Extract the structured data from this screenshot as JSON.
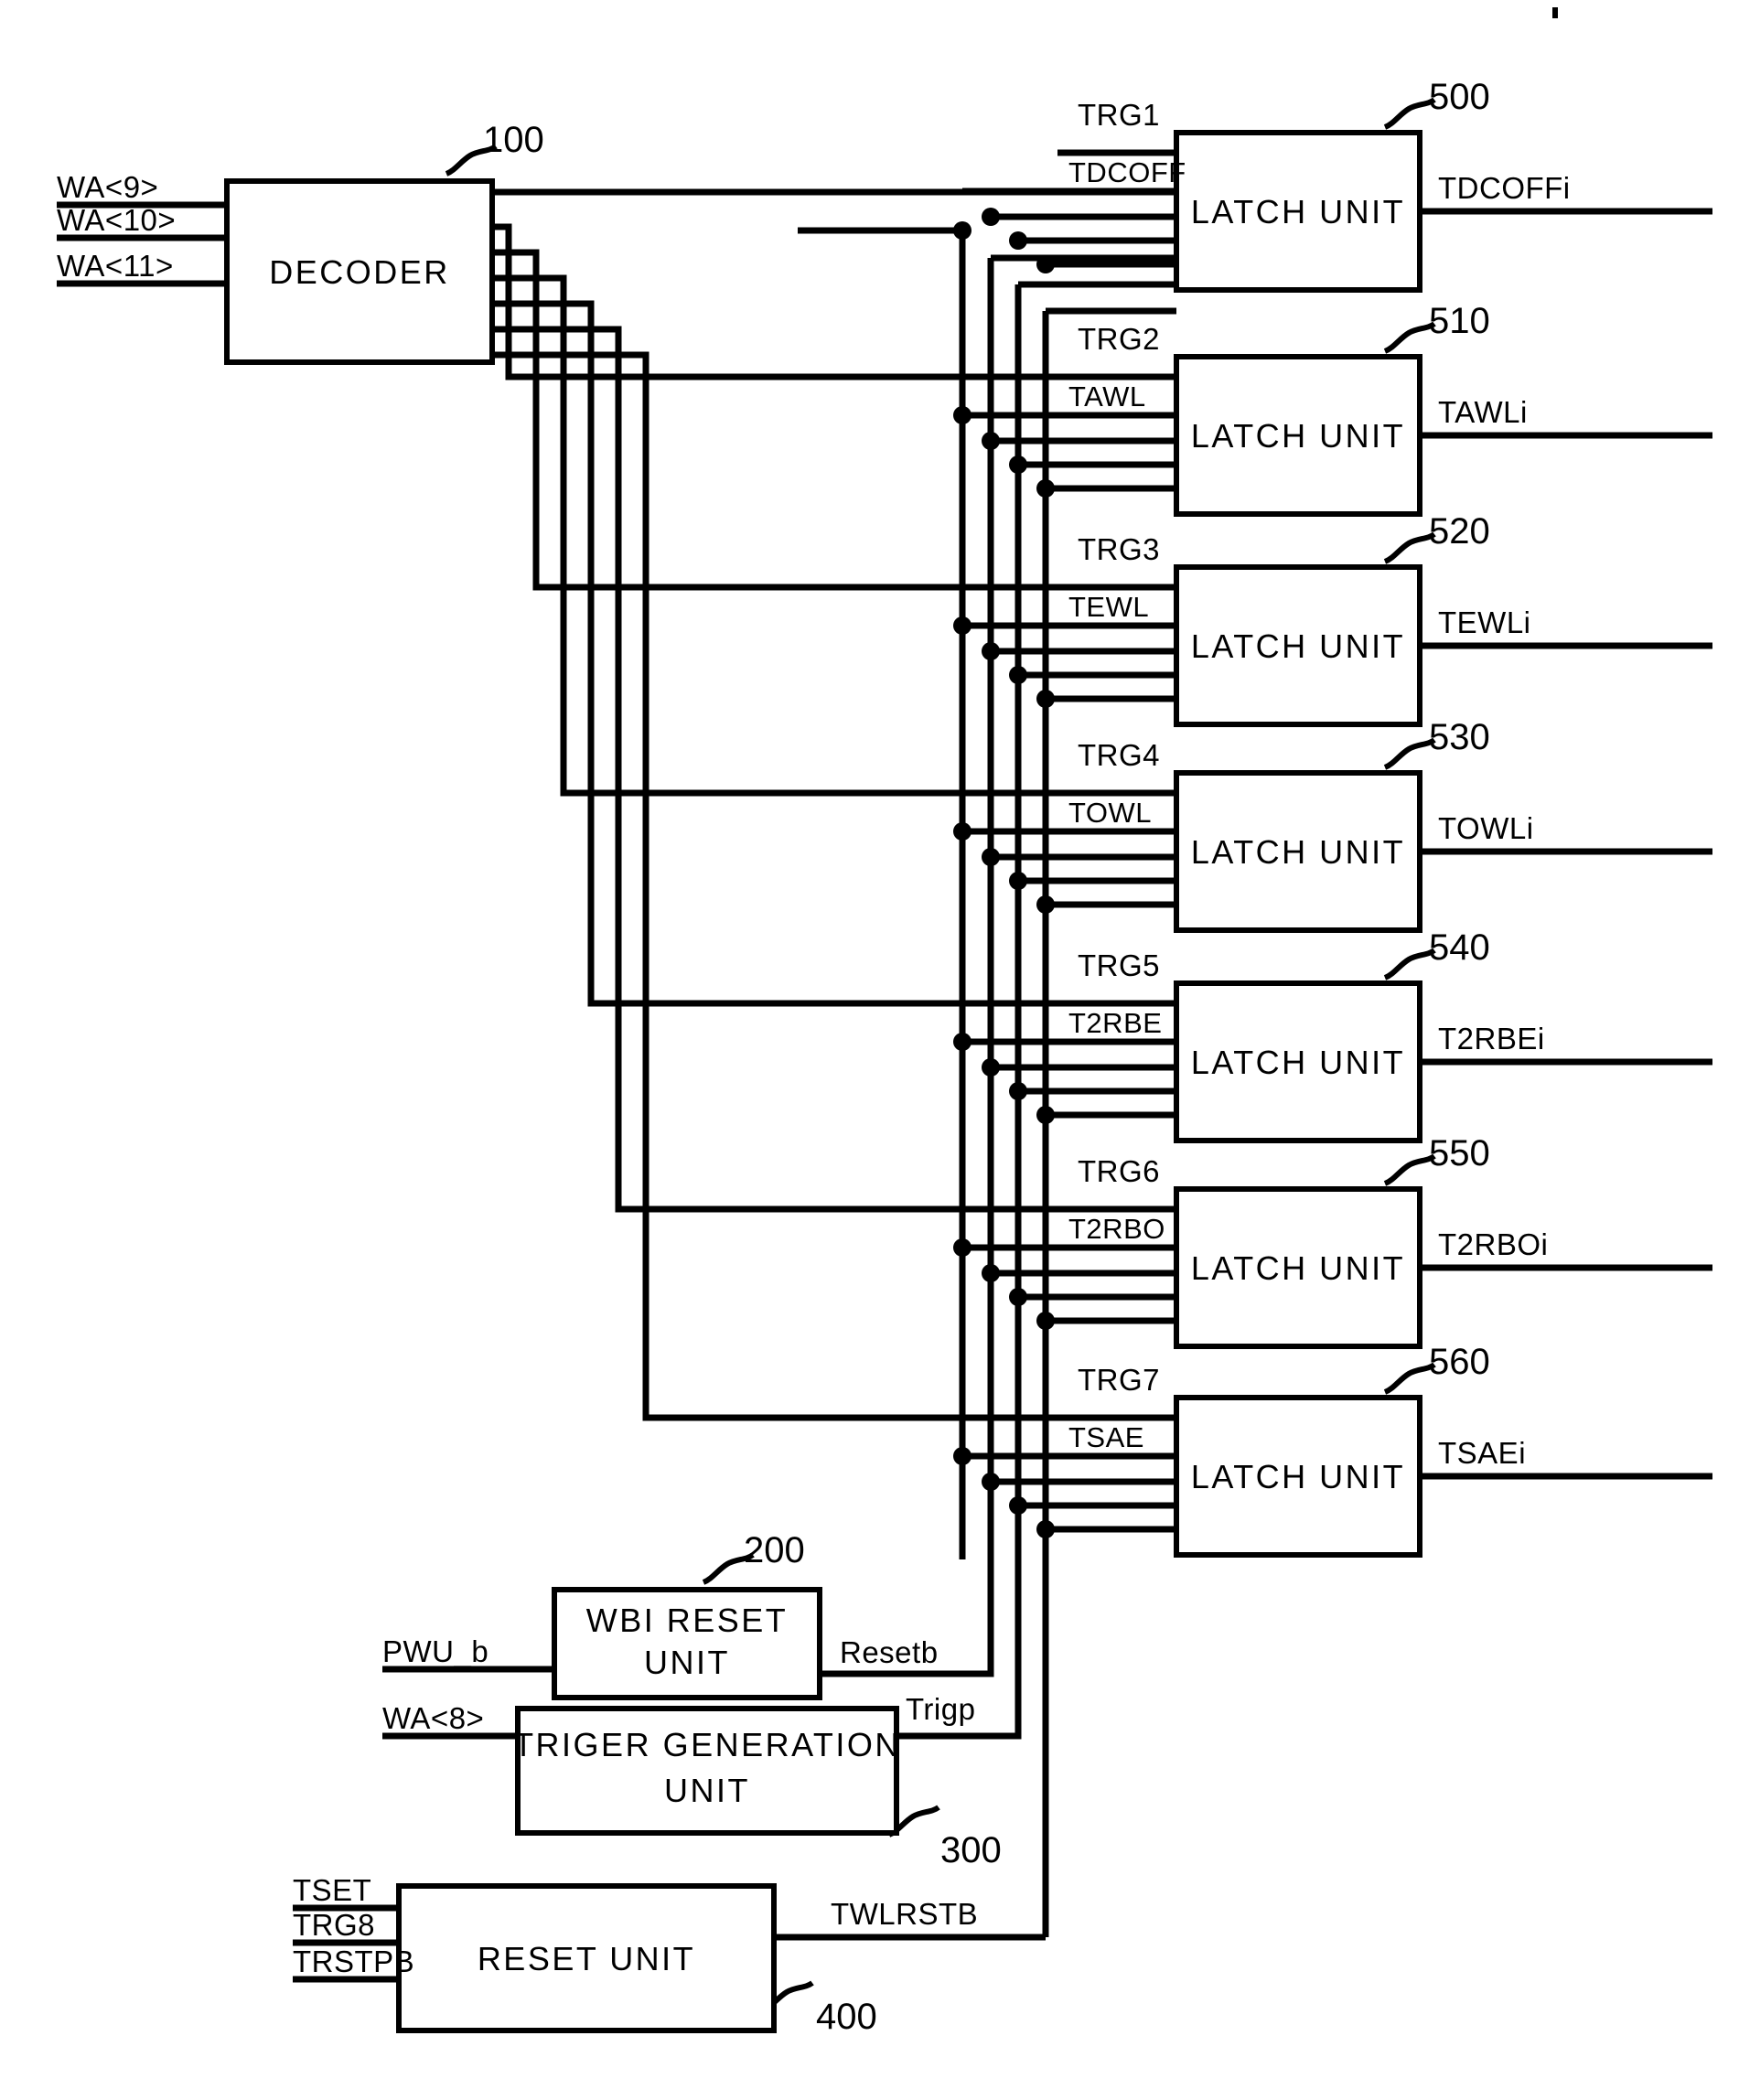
{
  "figure": {
    "kind": "patent-block-diagram",
    "ink_color": "#000000",
    "background": "#ffffff"
  },
  "blocks": {
    "decoder": {
      "label": "DECODER",
      "ref": "100",
      "inputs": [
        "WA<9>",
        "WA<10>",
        "WA<11>"
      ]
    },
    "wbi_reset": {
      "label_line1": "WBI RESET",
      "label_line2": "UNIT",
      "ref": "200",
      "inputs": [
        "PWU_b"
      ],
      "outputs": [
        "Resetb"
      ]
    },
    "trigger_generation": {
      "label_line1": "TRIGER GENERATION",
      "label_line2": "UNIT",
      "ref": "300",
      "inputs": [
        "WA<8>"
      ],
      "outputs": [
        "Trigp"
      ]
    },
    "reset_unit": {
      "label": "RESET UNIT",
      "ref": "400",
      "inputs": [
        "TSET",
        "TRG8",
        "TRSTPB"
      ],
      "outputs": [
        "TWLRSTB"
      ]
    }
  },
  "latch_units": [
    {
      "label": "LATCH UNIT",
      "ref": "500",
      "trg": "TRG1",
      "signal": "TDCOFF",
      "output": "TDCOFFi"
    },
    {
      "label": "LATCH UNIT",
      "ref": "510",
      "trg": "TRG2",
      "signal": "TAWL",
      "output": "TAWLi"
    },
    {
      "label": "LATCH UNIT",
      "ref": "520",
      "trg": "TRG3",
      "signal": "TEWL",
      "output": "TEWLi"
    },
    {
      "label": "LATCH UNIT",
      "ref": "530",
      "trg": "TRG4",
      "signal": "TOWL",
      "output": "TOWLi"
    },
    {
      "label": "LATCH UNIT",
      "ref": "540",
      "trg": "TRG5",
      "signal": "T2RBE",
      "output": "T2RBEi"
    },
    {
      "label": "LATCH UNIT",
      "ref": "550",
      "trg": "TRG6",
      "signal": "T2RBO",
      "output": "T2RBOi"
    },
    {
      "label": "LATCH UNIT",
      "ref": "560",
      "trg": "TRG7",
      "signal": "TSAE",
      "output": "TSAEi"
    }
  ],
  "bus_signals": {
    "tset": "TSET",
    "resetb": "Resetb",
    "trigp": "Trigp",
    "twlrstb": "TWLRSTB"
  }
}
